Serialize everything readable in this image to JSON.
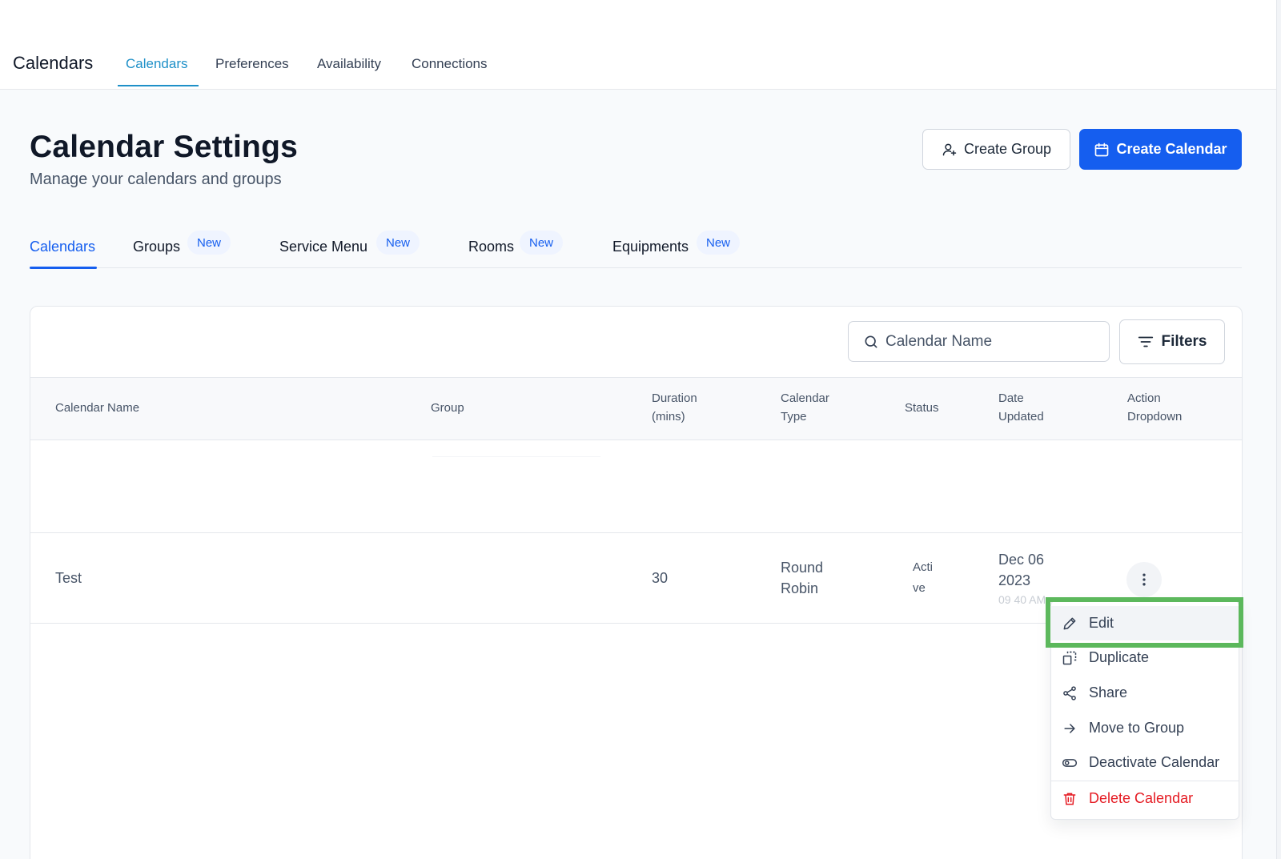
{
  "app": {
    "title": "Calendars",
    "top_tabs": [
      {
        "label": "Calendars",
        "active": true
      },
      {
        "label": "Preferences"
      },
      {
        "label": "Availability"
      },
      {
        "label": "Connections"
      }
    ]
  },
  "header": {
    "title": "Calendar Settings",
    "subtitle": "Manage your calendars and groups",
    "create_group_label": "Create Group",
    "create_calendar_label": "Create Calendar"
  },
  "sub_tabs": [
    {
      "label": "Calendars",
      "active": true
    },
    {
      "label": "Groups",
      "badge": "New"
    },
    {
      "label": "Service Menu",
      "badge": "New"
    },
    {
      "label": "Rooms",
      "badge": "New"
    },
    {
      "label": "Equipments",
      "badge": "New"
    }
  ],
  "search": {
    "placeholder": "Calendar Name"
  },
  "filters_label": "Filters",
  "table": {
    "columns": [
      {
        "line1": "Calendar Name",
        "line2": ""
      },
      {
        "line1": "Group",
        "line2": ""
      },
      {
        "line1": "Duration",
        "line2": "(mins)"
      },
      {
        "line1": "Calendar",
        "line2": "Type"
      },
      {
        "line1": "Status",
        "line2": ""
      },
      {
        "line1": "Date",
        "line2": "Updated"
      },
      {
        "line1": "Action",
        "line2": "Dropdown"
      }
    ],
    "rows": [
      {
        "name": "Test",
        "group": "",
        "duration": "30",
        "type_line1": "Round",
        "type_line2": "Robin",
        "status_line1": "Acti",
        "status_line2": "ve",
        "date_line1": "Dec 06",
        "date_line2": "2023",
        "time": "09 40 AM"
      }
    ]
  },
  "action_menu": {
    "items": [
      {
        "label": "Edit",
        "icon": "pencil-icon",
        "selected": true
      },
      {
        "label": "Duplicate",
        "icon": "duplicate-icon"
      },
      {
        "label": "Share",
        "icon": "share-icon"
      },
      {
        "label": "Move to Group",
        "icon": "arrow-right-icon"
      },
      {
        "label": "Deactivate Calendar",
        "icon": "toggle-icon"
      },
      {
        "label": "Delete Calendar",
        "icon": "trash-icon",
        "danger": true
      }
    ]
  },
  "colors": {
    "accent": "#155eef",
    "top_tab_active": "#1e90c8",
    "danger": "#e51b23",
    "highlight": "#5cb85c"
  }
}
